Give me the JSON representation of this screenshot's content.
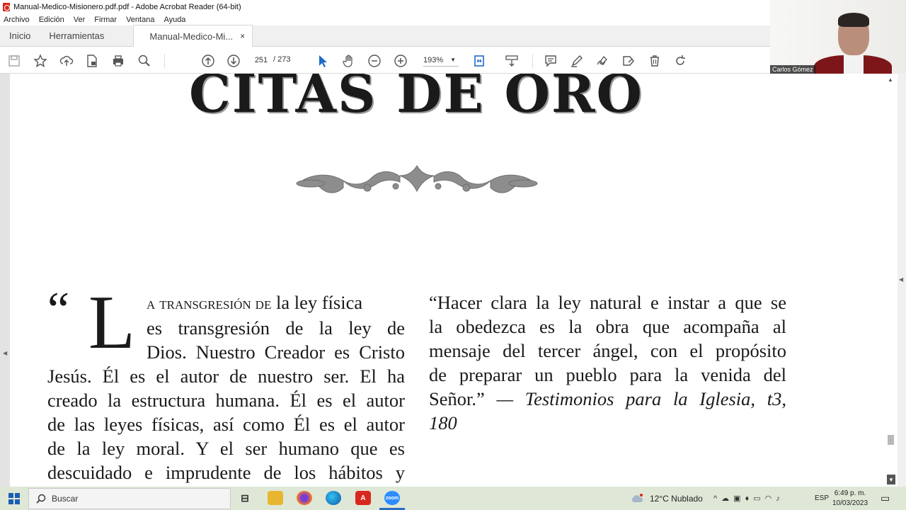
{
  "window": {
    "title": "Manual-Medico-Misionero.pdf.pdf - Adobe Acrobat Reader (64-bit)"
  },
  "menu": {
    "items": [
      "Archivo",
      "Edición",
      "Ver",
      "Firmar",
      "Ventana",
      "Ayuda"
    ]
  },
  "tabs": {
    "home": "Inicio",
    "tools": "Herramientas",
    "document": "Manual-Medico-Mi...",
    "close": "×"
  },
  "toolbar": {
    "current_page": "251",
    "page_total": "/ 273",
    "zoom": "193%",
    "icons": [
      "save-icon",
      "star-icon",
      "upload-icon",
      "lock-file-icon",
      "print-icon",
      "zoom-search-icon",
      "page-up-icon",
      "page-down-icon",
      "cursor-icon",
      "hand-icon",
      "zoom-out-icon",
      "zoom-in-icon",
      "fit-page-icon",
      "scroll-mode-icon",
      "comment-icon",
      "highlight-icon",
      "sign-icon",
      "edit-tag-icon",
      "trash-icon",
      "rotate-icon"
    ]
  },
  "video": {
    "participant_name": "Carlos Gómez"
  },
  "document": {
    "heading": "CITAS DE ORO",
    "left_quote_open": "“",
    "left_dropcap": "L",
    "left_lines": [
      {
        "sc": "a transgresión de",
        "rest": " la ley física"
      },
      {
        "text": "es transgresión de la ley de"
      },
      {
        "text": "Dios. Nuestro Creador es Cristo"
      },
      {
        "text": "Jesús. Él es el autor de nuestro ser. El ha"
      },
      {
        "text": "creado la estructura humana. Él es el autor"
      },
      {
        "text": "de las leyes físicas, así como Él es el autor"
      },
      {
        "text": "de la ley moral. Y el ser humano que es"
      },
      {
        "text": "descuidado e imprudente de los hábitos y"
      }
    ],
    "right_lines": [
      "“Hacer clara la ley natural e instar a que se",
      "la obedezca es la obra que acompaña al",
      "mensaje del tercer ángel, con el propósito",
      "de preparar un pueblo para la venida del"
    ],
    "right_line5_plain": "Señor.”",
    "right_line5_italic": " — Testimonios para la Iglesia, t3,",
    "right_line6_italic": "180"
  },
  "taskbar": {
    "search_placeholder": "Buscar",
    "weather": "12°C  Nublado",
    "language": "ESP",
    "time": "6:49 p. m.",
    "date": "10/03/2023",
    "apps": [
      "task-view",
      "file-explorer",
      "firefox",
      "edge",
      "acrobat",
      "zoom"
    ],
    "zoom_label": "zoom"
  }
}
